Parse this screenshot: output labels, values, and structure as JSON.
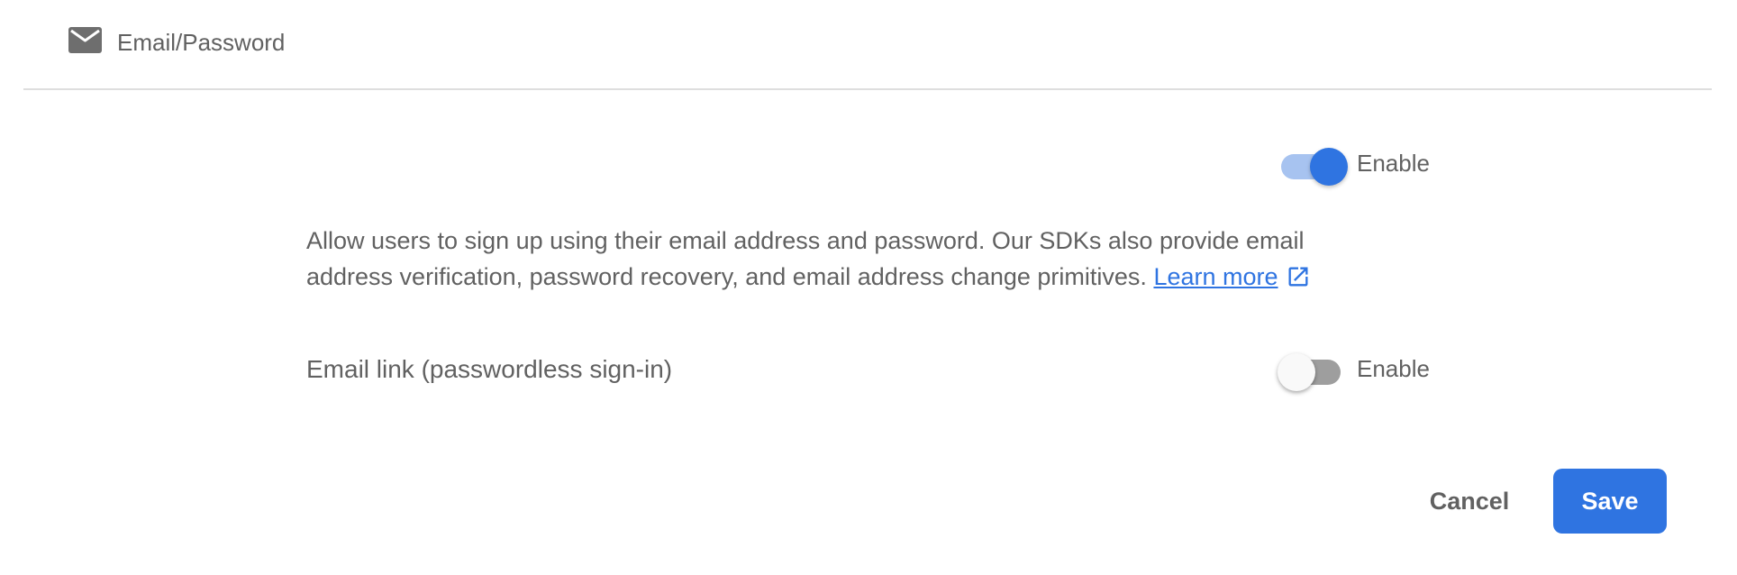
{
  "header": {
    "icon": "mail-icon",
    "title": "Email/Password"
  },
  "email_password": {
    "enabled": true,
    "enable_label": "Enable"
  },
  "description": {
    "text": "Allow users to sign up using their email address and password. Our SDKs also provide email address verification, password recovery, and email address change primitives. ",
    "link_label": "Learn more",
    "link_icon": "external-link-icon"
  },
  "email_link": {
    "label": "Email link (passwordless sign-in)",
    "enabled": false,
    "enable_label": "Enable"
  },
  "actions": {
    "cancel_label": "Cancel",
    "save_label": "Save"
  },
  "colors": {
    "accent": "#2f74e1",
    "text": "#616161",
    "toggle_on_track": "#a7c3f0",
    "toggle_off_track": "#9e9e9e"
  }
}
